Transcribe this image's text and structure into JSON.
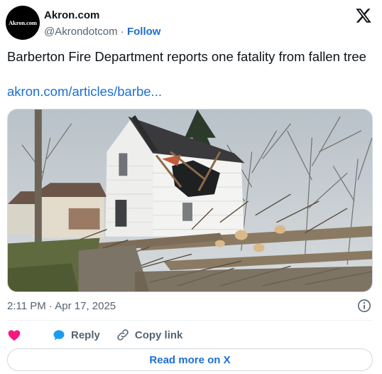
{
  "account": {
    "avatar_text": "Akron.com",
    "name": "Akron.com",
    "handle": "@Akrondotcom",
    "separator": "·",
    "follow_label": "Follow"
  },
  "tweet": {
    "text": "Barberton Fire Department reports one fatality from fallen tree",
    "link_text": "akron.com/articles/barbe...",
    "timestamp": "2:11 PM · Apr 17, 2025"
  },
  "actions": {
    "reply_label": "Reply",
    "copy_link_label": "Copy link"
  },
  "footer": {
    "read_more_label": "Read more on X"
  },
  "icons": {
    "brand": "x-logo-icon",
    "info": "info-icon",
    "like": "heart-icon",
    "reply": "reply-bubble-icon",
    "copy": "link-icon"
  },
  "colors": {
    "link": "#1d6fd1",
    "like": "#f91880",
    "secondary_text": "#536471",
    "border": "#cfd9de"
  }
}
